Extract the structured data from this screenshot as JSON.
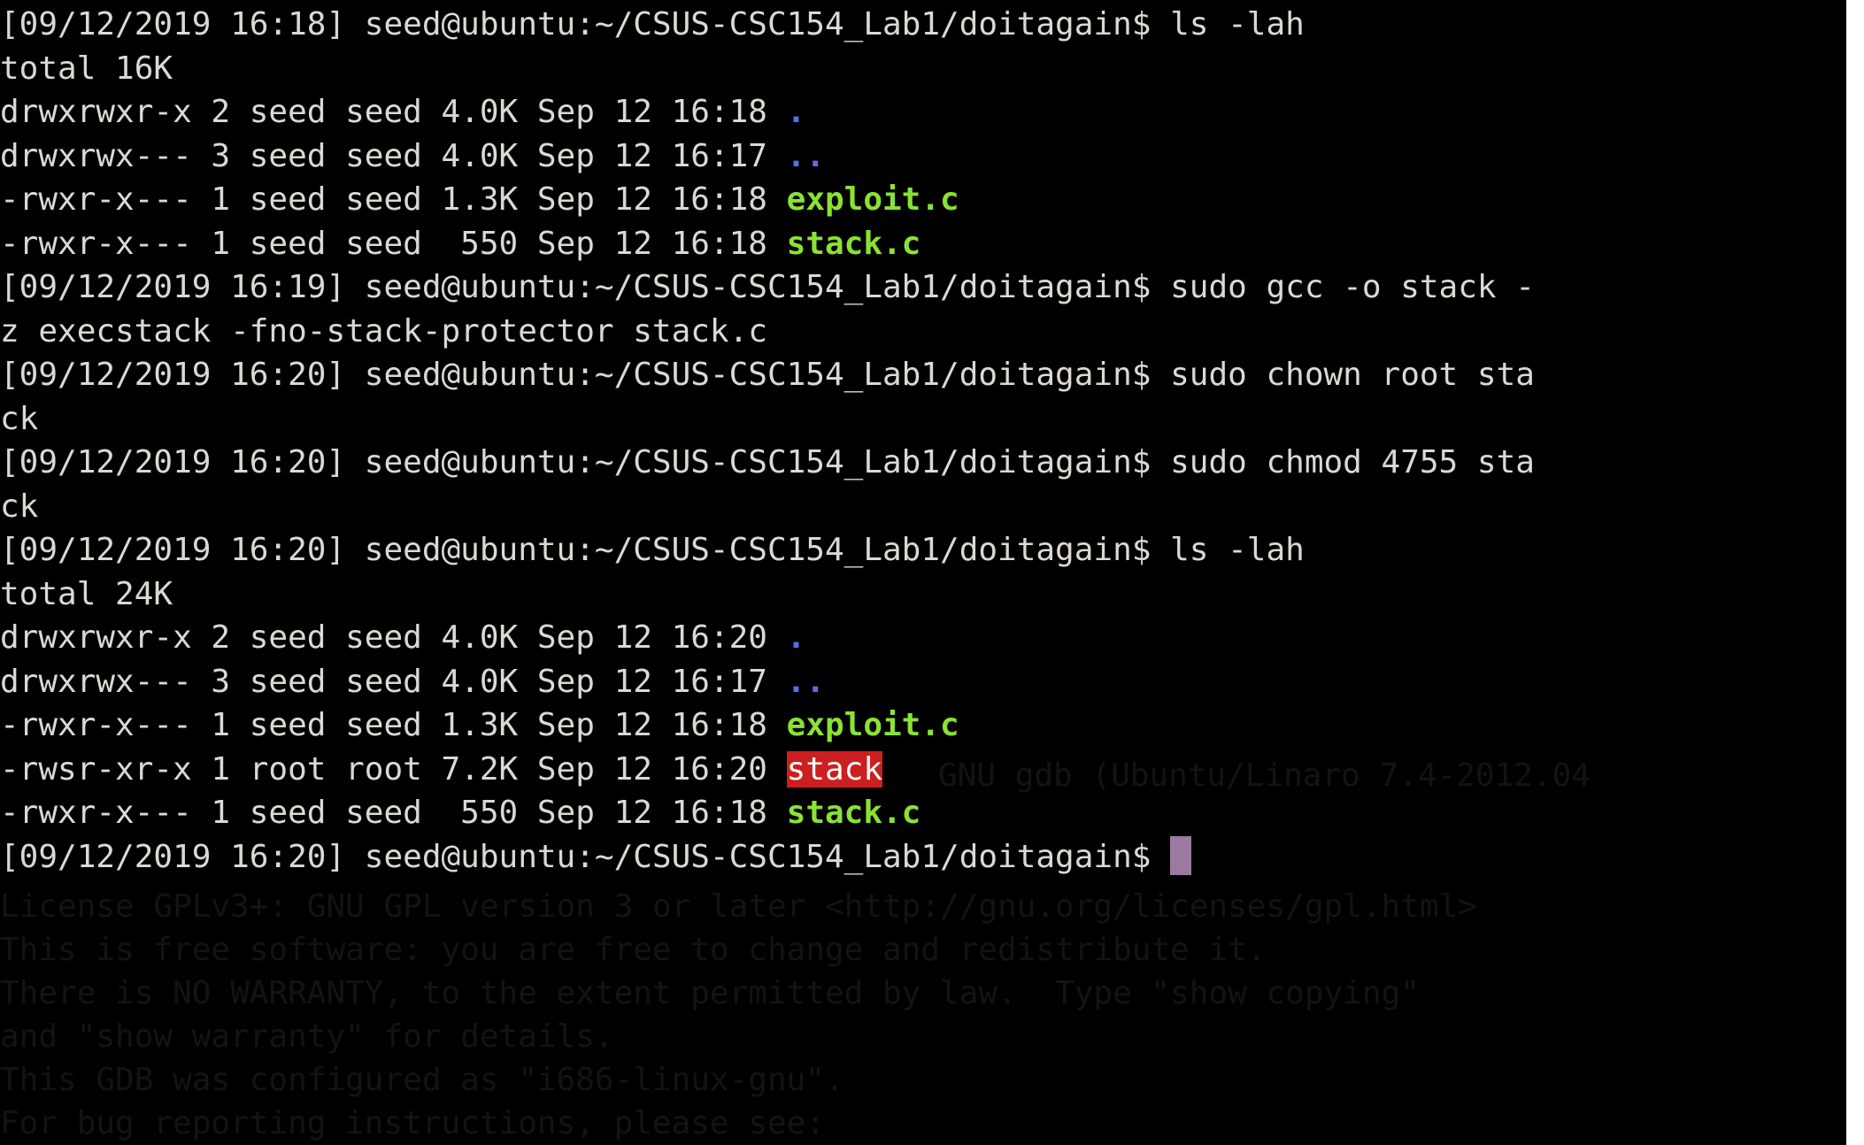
{
  "colors": {
    "background": "#000000",
    "text": "#dcd8d2",
    "directory": "#5c6cf0",
    "executable": "#8ae234",
    "setuid_background": "#cc1f1f",
    "cursor": "#9a7aa0"
  },
  "terminal": {
    "l1": {
      "prompt": "[09/12/2019 16:18] seed@ubuntu:~/CSUS-CSC154_Lab1/doitagain$ ",
      "command": "ls -lah"
    },
    "l2": {
      "text": "total 16K"
    },
    "l3": {
      "meta": "drwxrwxr-x 2 seed seed 4.0K Sep 12 16:18 ",
      "name": "."
    },
    "l4": {
      "meta": "drwxrwx--- 3 seed seed 4.0K Sep 12 16:17 ",
      "name": ".."
    },
    "l5": {
      "meta": "-rwxr-x--- 1 seed seed 1.3K Sep 12 16:18 ",
      "name": "exploit.c"
    },
    "l6": {
      "meta": "-rwxr-x--- 1 seed seed  550 Sep 12 16:18 ",
      "name": "stack.c"
    },
    "l7": {
      "prompt": "[09/12/2019 16:19] seed@ubuntu:~/CSUS-CSC154_Lab1/doitagain$ ",
      "command": "sudo gcc -o stack -"
    },
    "l8": {
      "text": "z execstack -fno-stack-protector stack.c"
    },
    "l9": {
      "prompt": "[09/12/2019 16:20] seed@ubuntu:~/CSUS-CSC154_Lab1/doitagain$ ",
      "command": "sudo chown root sta"
    },
    "l10": {
      "text": "ck"
    },
    "l11": {
      "prompt": "[09/12/2019 16:20] seed@ubuntu:~/CSUS-CSC154_Lab1/doitagain$ ",
      "command": "sudo chmod 4755 sta"
    },
    "l12": {
      "text": "ck"
    },
    "l13": {
      "prompt": "[09/12/2019 16:20] seed@ubuntu:~/CSUS-CSC154_Lab1/doitagain$ ",
      "command": "ls -lah"
    },
    "l14": {
      "text": "total 24K"
    },
    "l15": {
      "meta": "drwxrwxr-x 2 seed seed 4.0K Sep 12 16:20 ",
      "name": "."
    },
    "l16": {
      "meta": "drwxrwx--- 3 seed seed 4.0K Sep 12 16:17 ",
      "name": ".."
    },
    "l17": {
      "meta": "-rwxr-x--- 1 seed seed 1.3K Sep 12 16:18 ",
      "name": "exploit.c"
    },
    "l18": {
      "meta": "-rwsr-xr-x 1 root root 7.2K Sep 12 16:20 ",
      "name": "stack"
    },
    "l19": {
      "meta": "-rwxr-x--- 1 seed seed  550 Sep 12 16:18 ",
      "name": "stack.c"
    },
    "l20": {
      "prompt": "[09/12/2019 16:20] seed@ubuntu:~/CSUS-CSC154_Lab1/doitagain$ "
    }
  },
  "ghost": {
    "g1": "GNU gdb (Ubuntu/Linaro 7.4-2012.04",
    "g2": "License GPLv3+: GNU GPL version 3 or later <http://gnu.org/licenses/gpl.html>",
    "g3": "This is free software: you are free to change and redistribute it.",
    "g4": "There is NO WARRANTY, to the extent permitted by law.  Type \"show copying\"",
    "g5": "and \"show warranty\" for details.",
    "g6": "This GDB was configured as \"i686-linux-gnu\".",
    "g7": "For bug reporting instructions, please see:"
  }
}
